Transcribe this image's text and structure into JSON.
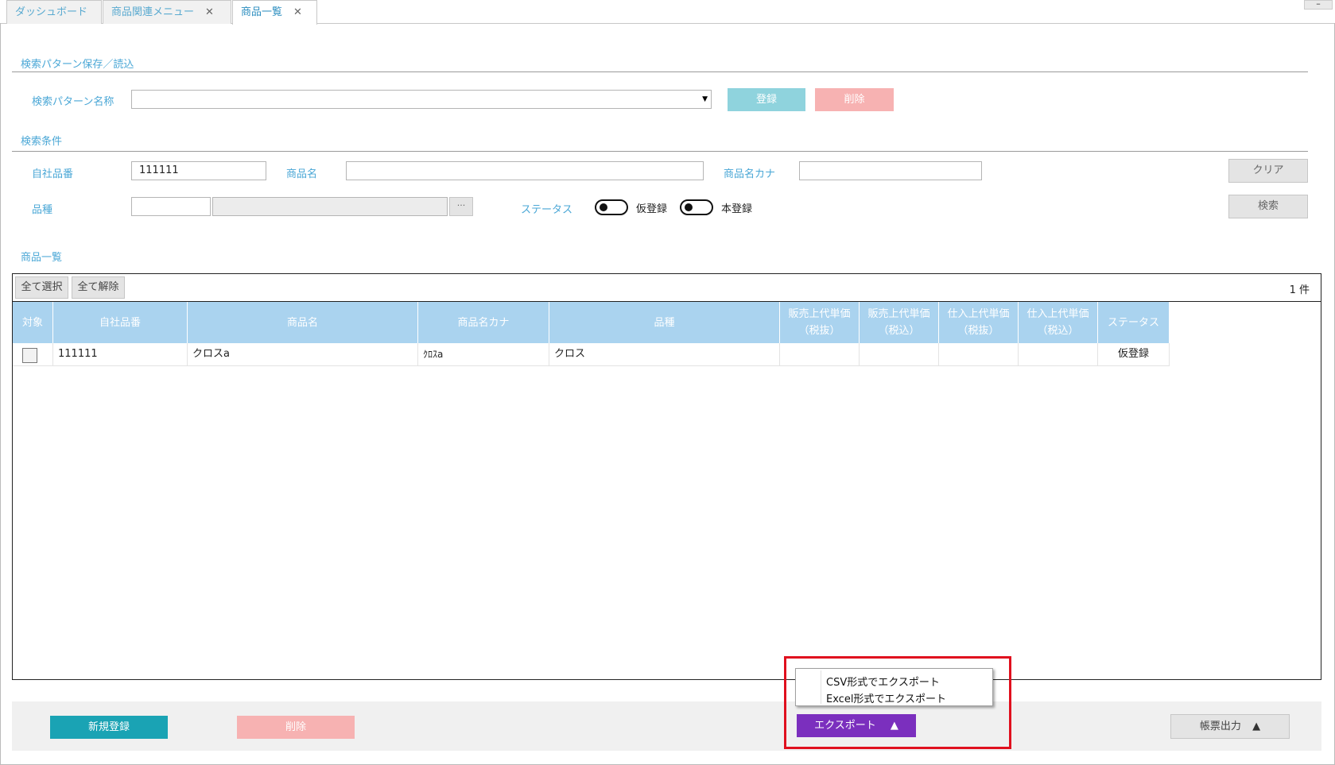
{
  "tabs": [
    {
      "label": "ダッシュボード"
    },
    {
      "label": "商品関連メニュー",
      "close": "✕"
    },
    {
      "label": "商品一覧",
      "close": "✕"
    }
  ],
  "window_minimize": "–",
  "search_pattern": {
    "section_title": "検索パターン保存／読込",
    "name_label": "検索パターン名称",
    "name_value": "",
    "register_button": "登録",
    "delete_button": "削除"
  },
  "search_conditions": {
    "section_title": "検索条件",
    "product_code_label": "自社品番",
    "product_code_value": "111111",
    "product_name_label": "商品名",
    "product_name_value": "",
    "product_kana_label": "商品名カナ",
    "product_kana_value": "",
    "clear_button": "クリア",
    "variety_label": "品種",
    "variety_code_value": "",
    "variety_name_value": "",
    "browse_button": "···",
    "status_label": "ステータス",
    "status_provisional": "仮登録",
    "status_full": "本登録",
    "search_button": "検索"
  },
  "product_list": {
    "section_title": "商品一覧",
    "select_all": "全て選択",
    "deselect_all": "全て解除",
    "count": "1 件",
    "columns": [
      {
        "l1": "対象",
        "l2": ""
      },
      {
        "l1": "自社品番",
        "l2": ""
      },
      {
        "l1": "商品名",
        "l2": ""
      },
      {
        "l1": "商品名カナ",
        "l2": ""
      },
      {
        "l1": "品種",
        "l2": ""
      },
      {
        "l1": "販売上代単価",
        "l2": "（税抜）"
      },
      {
        "l1": "販売上代単価",
        "l2": "（税込）"
      },
      {
        "l1": "仕入上代単価",
        "l2": "（税抜）"
      },
      {
        "l1": "仕入上代単価",
        "l2": "（税込）"
      },
      {
        "l1": "ステータス",
        "l2": ""
      }
    ],
    "rows": [
      {
        "checked": false,
        "code": "111111",
        "name": "クロスa",
        "kana": "ｸﾛｽa",
        "variety": "クロス",
        "sell_ex": "",
        "sell_in": "",
        "buy_ex": "",
        "buy_in": "",
        "status": "仮登録"
      }
    ]
  },
  "footer": {
    "new_button": "新規登録",
    "delete_button": "削除",
    "export_button": "エクスポート",
    "export_arrow": "▲",
    "report_button": "帳票出力",
    "report_arrow": "▲",
    "export_menu": [
      {
        "label": "CSV形式でエクスポート"
      },
      {
        "label": "Excel形式でエクスポート"
      }
    ]
  },
  "colors": {
    "accent_label": "#4aa7d6",
    "header_blue": "#aad3ef",
    "teal": "#1aa3b4",
    "purple": "#7b2fbe",
    "highlight_red": "#e0101e"
  }
}
